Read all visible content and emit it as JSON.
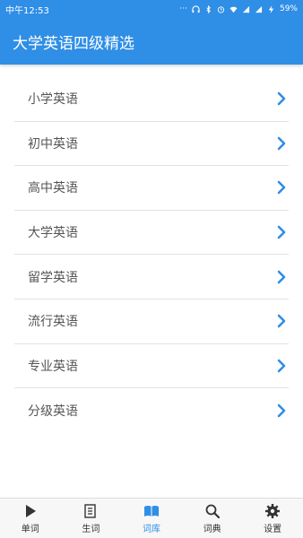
{
  "status_bar": {
    "time": "中午12:53",
    "battery": "59%",
    "icons": [
      "more-icon",
      "headphones-icon",
      "bluetooth-icon",
      "alarm-icon",
      "wifi-icon",
      "signal-icon",
      "signal-icon",
      "charging-icon"
    ]
  },
  "app_bar": {
    "title": "大学英语四级精选"
  },
  "list": {
    "items": [
      {
        "label": "小学英语"
      },
      {
        "label": "初中英语"
      },
      {
        "label": "高中英语"
      },
      {
        "label": "大学英语"
      },
      {
        "label": "留学英语"
      },
      {
        "label": "流行英语"
      },
      {
        "label": "专业英语"
      },
      {
        "label": "分级英语"
      }
    ]
  },
  "bottom_nav": {
    "active": "词库",
    "items": [
      {
        "label": "单词",
        "icon": "play-icon"
      },
      {
        "label": "生词",
        "icon": "document-icon"
      },
      {
        "label": "词库",
        "icon": "book-icon"
      },
      {
        "label": "词典",
        "icon": "search-icon"
      },
      {
        "label": "设置",
        "icon": "gear-icon"
      }
    ]
  },
  "colors": {
    "primary": "#2f8ee6",
    "chevron": "#2f8ee6",
    "text": "#555555"
  }
}
